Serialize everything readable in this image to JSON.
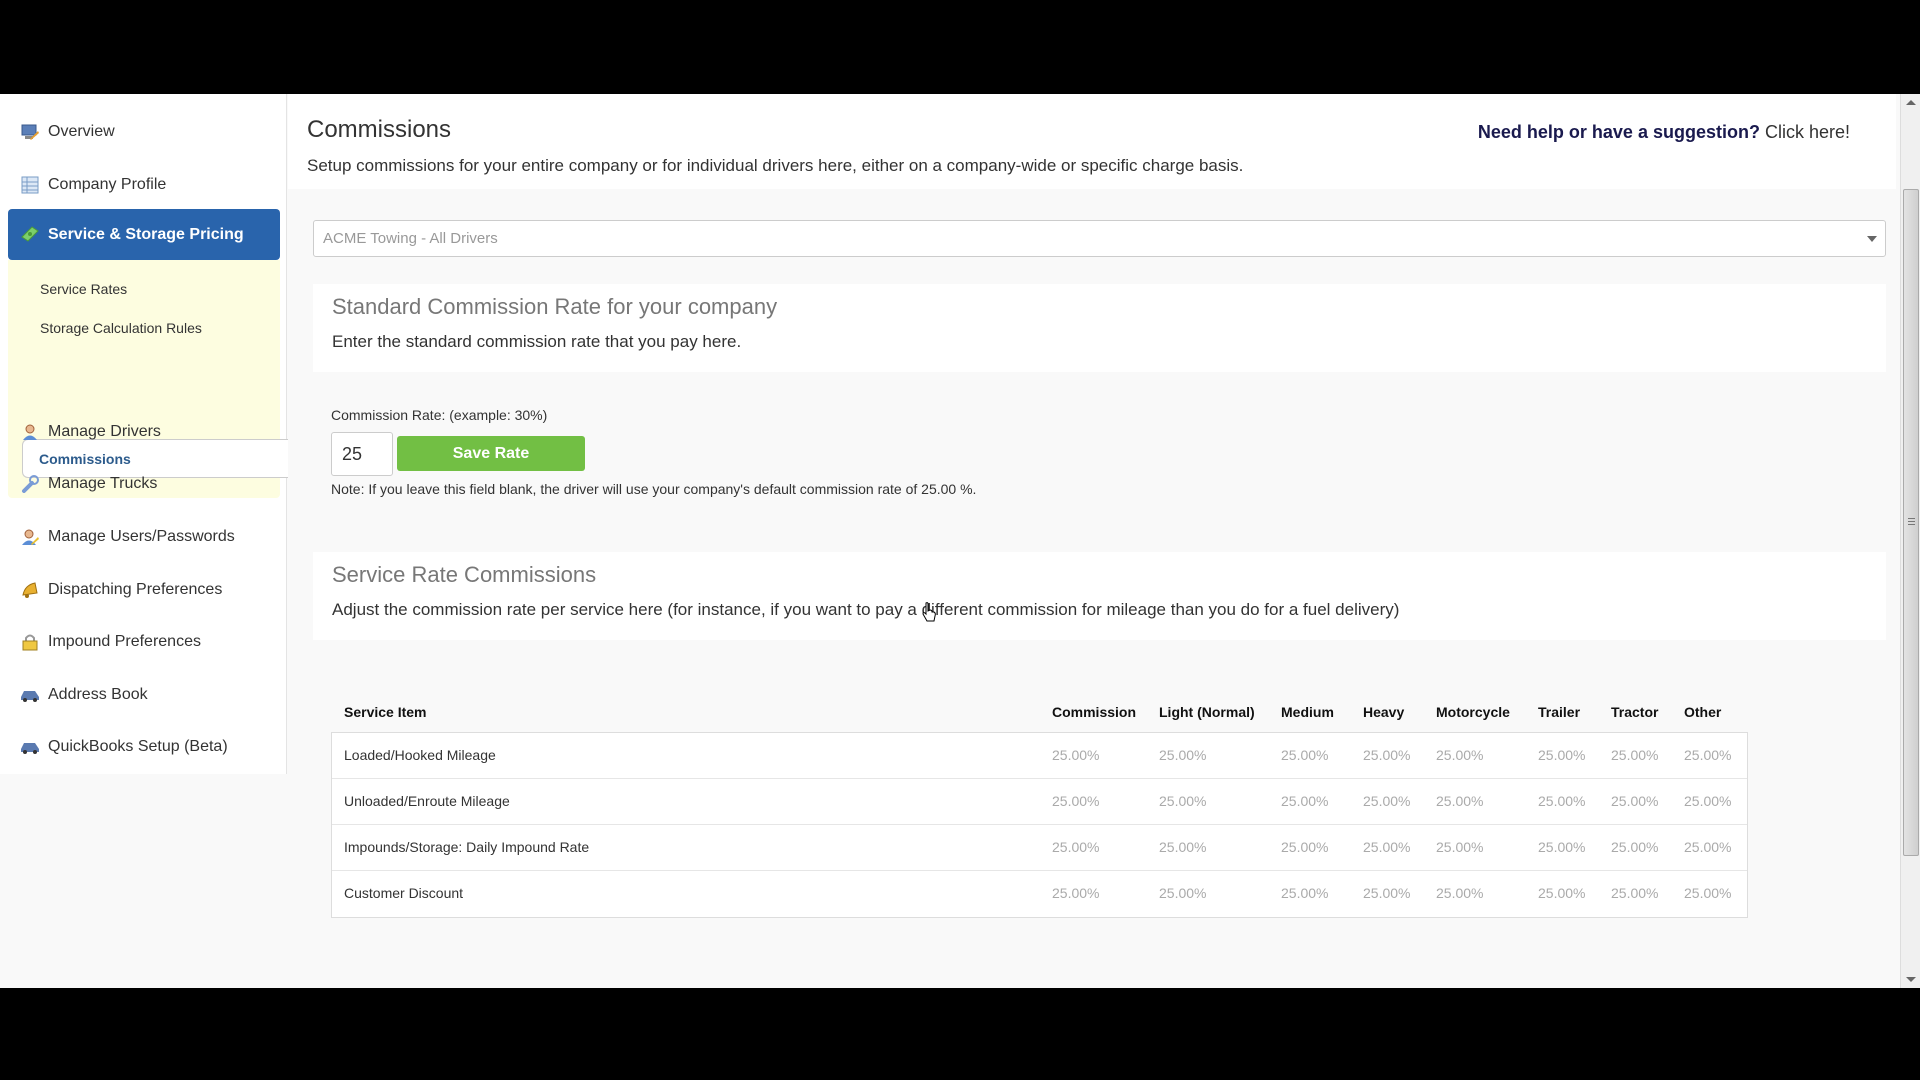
{
  "sidebar": {
    "items": [
      {
        "label": "Overview",
        "icon": "monitor-pencil-icon"
      },
      {
        "label": "Company Profile",
        "icon": "spreadsheet-icon"
      },
      {
        "label": "Service & Storage Pricing",
        "icon": "money-icon",
        "active": true
      },
      {
        "label": "Manage Drivers",
        "icon": "user-icon"
      },
      {
        "label": "Manage Trucks",
        "icon": "wrench-icon"
      },
      {
        "label": "Manage Users/Passwords",
        "icon": "user-edit-icon"
      },
      {
        "label": "Dispatching Preferences",
        "icon": "bell-icon"
      },
      {
        "label": "Impound Preferences",
        "icon": "lock-icon"
      },
      {
        "label": "Address Book",
        "icon": "car-icon"
      },
      {
        "label": "QuickBooks Setup (Beta)",
        "icon": "car-icon"
      }
    ],
    "subitems": [
      {
        "label": "Service Rates"
      },
      {
        "label": "Storage Calculation Rules"
      },
      {
        "label": "Commissions",
        "active": true
      }
    ]
  },
  "header": {
    "title": "Commissions",
    "subtitle": "Setup commissions for your entire company or for individual drivers here, either on a company-wide or specific charge basis.",
    "help_bold": "Need help or have a suggestion?",
    "help_link": "Click here!"
  },
  "driver_select": {
    "value": "ACME Towing - All Drivers"
  },
  "standard": {
    "title": "Standard Commission Rate for your company",
    "desc": "Enter the standard commission rate that you pay here.",
    "rate_label": "Commission Rate: (example: 30%)",
    "rate_value": "25",
    "save_label": "Save Rate",
    "note": "Note: If you leave this field blank, the driver will use your company's default commission rate of 25.00 %."
  },
  "service": {
    "title": "Service Rate Commissions",
    "desc": "Adjust the commission rate per service here (for instance, if you want to pay a different commission for mileage than you do for a fuel delivery)",
    "columns": [
      "Service Item",
      "Commission",
      "Light (Normal)",
      "Medium",
      "Heavy",
      "Motorcycle",
      "Trailer",
      "Tractor",
      "Other"
    ],
    "rows": [
      {
        "item": "Loaded/Hooked Mileage",
        "values": [
          "25.00%",
          "25.00%",
          "25.00%",
          "25.00%",
          "25.00%",
          "25.00%",
          "25.00%",
          "25.00%"
        ]
      },
      {
        "item": "Unloaded/Enroute Mileage",
        "values": [
          "25.00%",
          "25.00%",
          "25.00%",
          "25.00%",
          "25.00%",
          "25.00%",
          "25.00%",
          "25.00%"
        ]
      },
      {
        "item": "Impounds/Storage: Daily Impound Rate",
        "values": [
          "25.00%",
          "25.00%",
          "25.00%",
          "25.00%",
          "25.00%",
          "25.00%",
          "25.00%",
          "25.00%"
        ]
      },
      {
        "item": "Customer Discount",
        "values": [
          "25.00%",
          "25.00%",
          "25.00%",
          "25.00%",
          "25.00%",
          "25.00%",
          "25.00%",
          "25.00%"
        ]
      }
    ]
  },
  "colors": {
    "active_nav": "#2964ac",
    "subnav_bg": "#fdfde0",
    "save_button": "#72bf44",
    "help_text": "#1a1a4e"
  }
}
